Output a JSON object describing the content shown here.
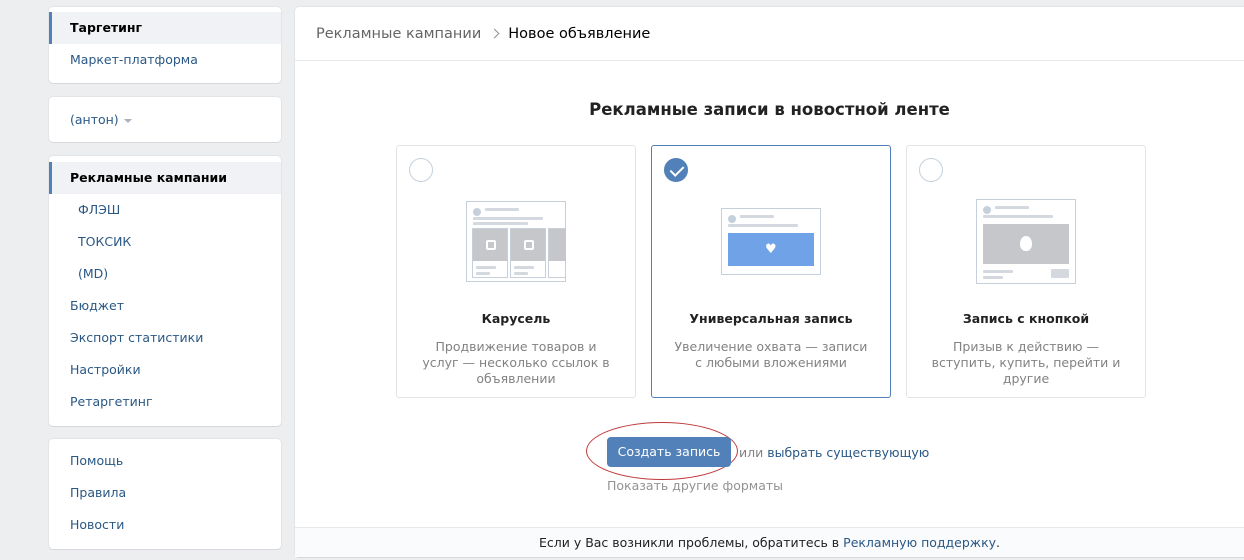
{
  "sidebar": {
    "top": [
      {
        "label": "Таргетинг",
        "active": true
      },
      {
        "label": "Маркет-платформа"
      }
    ],
    "account": {
      "label": "(антон)"
    },
    "campaigns": [
      {
        "label": "Рекламные кампании",
        "active": true
      },
      {
        "label": "ФЛЭШ",
        "sub": true
      },
      {
        "label": "ТОКСИК",
        "sub": true
      },
      {
        "label": "(MD)",
        "sub": true
      },
      {
        "label": "Бюджет"
      },
      {
        "label": "Экспорт статистики"
      },
      {
        "label": "Настройки"
      },
      {
        "label": "Ретаргетинг"
      }
    ],
    "help": [
      {
        "label": "Помощь"
      },
      {
        "label": "Правила"
      },
      {
        "label": "Новости"
      }
    ]
  },
  "breadcrumb": {
    "parent": "Рекламные кампании",
    "current": "Новое объявление"
  },
  "section_title": "Рекламные записи в новостной ленте",
  "formats": [
    {
      "title": "Карусель",
      "desc": "Продвижение товаров и услуг — несколько ссылок в объявлении",
      "selected": false,
      "icon": "carousel-illustration"
    },
    {
      "title": "Универсальная запись",
      "desc": "Увеличение охвата — записи с любыми вложениями",
      "selected": true,
      "icon": "universal-post-illustration"
    },
    {
      "title": "Запись с кнопкой",
      "desc": "Призыв к действию — вступить, купить, перейти и другие",
      "selected": false,
      "icon": "button-post-illustration"
    }
  ],
  "actions": {
    "create": "Создать запись",
    "or": "или",
    "choose_existing": "выбрать существующую",
    "more_formats": "Показать другие форматы"
  },
  "footer": {
    "text": "Если у Вас возникли проблемы, обратитесь в",
    "link": "Рекламную поддержку",
    "end": "."
  },
  "colors": {
    "accent": "#5181b8",
    "link": "#2a5885",
    "background": "#edeef0",
    "illustration_blue": "#6fa2e6",
    "illustration_gray": "#c5c7cb",
    "annotation_red": "#c03a3a"
  }
}
